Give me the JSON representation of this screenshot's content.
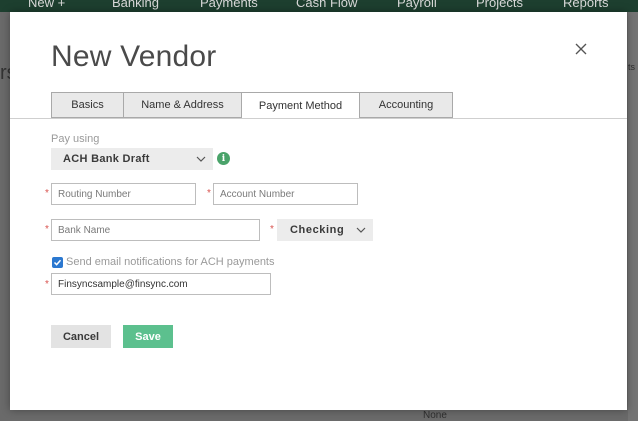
{
  "background": {
    "nav_items": [
      "New +",
      "Banking",
      "Payments",
      "Cash Flow",
      "Payroll",
      "Projects",
      "Reports"
    ],
    "right_fragment": "ts",
    "left_fragment": "rs",
    "bottom_text": "None"
  },
  "modal": {
    "title": "New Vendor",
    "tabs": [
      {
        "label": "Basics",
        "active": false
      },
      {
        "label": "Name & Address",
        "active": false
      },
      {
        "label": "Payment Method",
        "active": true
      },
      {
        "label": "Accounting",
        "active": false
      }
    ],
    "pay_using": {
      "label": "Pay using",
      "selected": "ACH Bank Draft",
      "info_glyph": "i"
    },
    "routing_number": {
      "placeholder": "Routing Number",
      "value": ""
    },
    "account_number": {
      "placeholder": "Account Number",
      "value": ""
    },
    "bank_name": {
      "placeholder": "Bank Name",
      "value": ""
    },
    "account_type": {
      "selected": "Checking"
    },
    "email_notifications": {
      "checked": true,
      "label": "Send email notifications for ACH payments"
    },
    "email": {
      "value": "Finsyncsample@finsync.com"
    },
    "required_marker": "*",
    "buttons": {
      "cancel": "Cancel",
      "save": "Save"
    }
  },
  "colors": {
    "accent_green": "#5cc08e",
    "info_green": "#4aa36a",
    "checkbox_blue": "#2b78d0",
    "required_red": "#d9534f"
  }
}
